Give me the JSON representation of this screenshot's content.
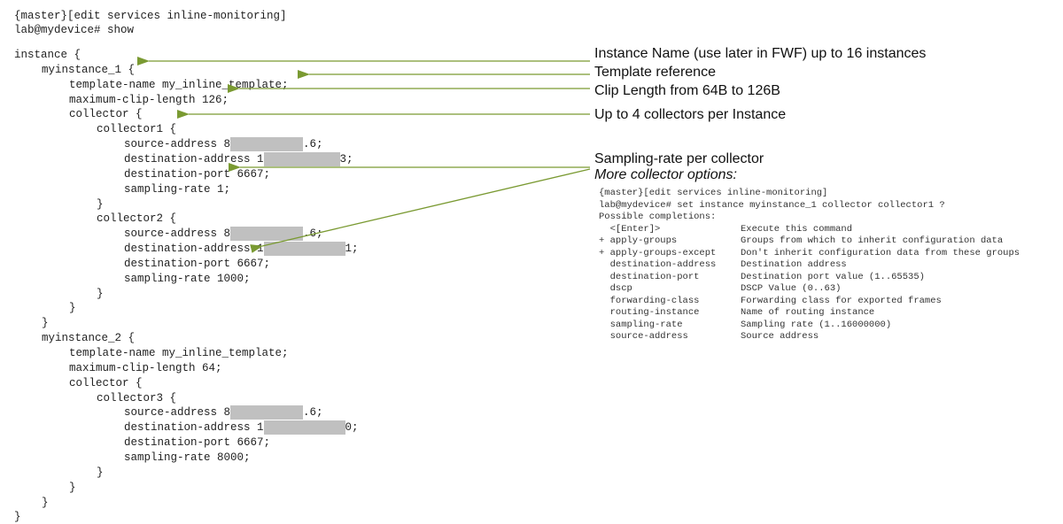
{
  "code": {
    "lines": [
      {
        "indent": 0,
        "text": "{master}[edit services inline-monitoring]"
      },
      {
        "indent": 0,
        "text": "lab@mydevice# show"
      },
      {
        "indent": 0,
        "text": "instance {"
      },
      {
        "indent": 1,
        "text": "myinstance_1 {"
      },
      {
        "indent": 2,
        "text": "template-name my_inline_template;"
      },
      {
        "indent": 2,
        "text": "maximum-clip-length 126;"
      },
      {
        "indent": 2,
        "text": "collector {"
      },
      {
        "indent": 3,
        "text": "collector1 {"
      },
      {
        "indent": 4,
        "text": "source-address 8",
        "redacted": "s",
        "after": ".6;"
      },
      {
        "indent": 4,
        "text": "destination-address 1",
        "redacted": "d",
        "after": "3;"
      },
      {
        "indent": 4,
        "text": "destination-port 6667;"
      },
      {
        "indent": 4,
        "text": "sampling-rate 1;"
      },
      {
        "indent": 3,
        "text": "}"
      },
      {
        "indent": 3,
        "text": "collector2 {"
      },
      {
        "indent": 4,
        "text": "source-address 8",
        "redacted": "s",
        "after": ".6;"
      },
      {
        "indent": 4,
        "text": "destination-address 1",
        "redacted": "d2",
        "after": "1;"
      },
      {
        "indent": 4,
        "text": "destination-port 6667;"
      },
      {
        "indent": 4,
        "text": "sampling-rate 1000;"
      },
      {
        "indent": 3,
        "text": "}"
      },
      {
        "indent": 2,
        "text": "}"
      },
      {
        "indent": 1,
        "text": "}"
      },
      {
        "indent": 1,
        "text": "myinstance_2 {"
      },
      {
        "indent": 2,
        "text": "template-name my_inline_template;"
      },
      {
        "indent": 2,
        "text": "maximum-clip-length 64;"
      },
      {
        "indent": 2,
        "text": "collector {"
      },
      {
        "indent": 3,
        "text": "collector3 {"
      },
      {
        "indent": 4,
        "text": "source-address 8",
        "redacted": "s",
        "after": ".6;"
      },
      {
        "indent": 4,
        "text": "destination-address 1",
        "redacted": "d2",
        "after": "0;"
      },
      {
        "indent": 4,
        "text": "destination-port 6667;"
      },
      {
        "indent": 4,
        "text": "sampling-rate 8000;"
      },
      {
        "indent": 3,
        "text": "}"
      },
      {
        "indent": 2,
        "text": "}"
      },
      {
        "indent": 1,
        "text": "}"
      },
      {
        "indent": 0,
        "text": "}"
      }
    ]
  },
  "annotations": {
    "instance_name": "Instance Name (use later in FWF) up to 16 instances",
    "template_reference": "Template reference",
    "clip_length": "Clip Length from 64B to 126B",
    "collectors": "Up to 4 collectors per Instance",
    "sampling_rate": "Sampling-rate per collector",
    "more_options": "More collector options:"
  },
  "terminal": {
    "prompt_context": "{master}[edit services inline-monitoring]",
    "command": "lab@mydevice# set instance myinstance_1 collector collector1 ?",
    "header": "Possible completions:",
    "completions": [
      {
        "name": "  <[Enter]>",
        "desc": "Execute this command"
      },
      {
        "name": "+ apply-groups",
        "desc": "Groups from which to inherit configuration data"
      },
      {
        "name": "+ apply-groups-except",
        "desc": "Don't inherit configuration data from these groups"
      },
      {
        "name": "  destination-address",
        "desc": "Destination address"
      },
      {
        "name": "  destination-port",
        "desc": "Destination port value (1..65535)"
      },
      {
        "name": "  dscp",
        "desc": "DSCP Value (0..63)"
      },
      {
        "name": "  forwarding-class",
        "desc": "Forwarding class for exported frames"
      },
      {
        "name": "  routing-instance",
        "desc": "Name of routing instance"
      },
      {
        "name": "  sampling-rate",
        "desc": "Sampling rate (1..16000000)"
      },
      {
        "name": "  source-address",
        "desc": "Source address"
      }
    ]
  },
  "colors": {
    "arrow": "#7a9a32",
    "redaction": "#c0c0c0"
  }
}
